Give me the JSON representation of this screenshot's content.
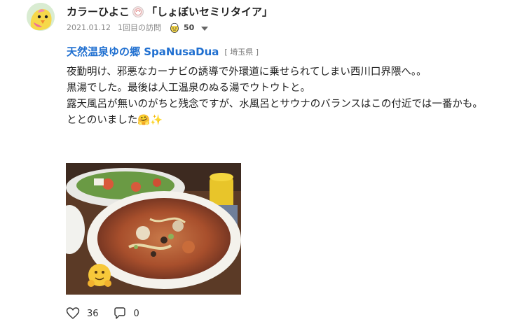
{
  "user": {
    "name": "カラーひよこ",
    "title": "「しょぼいセミリタイア」"
  },
  "meta": {
    "date": "2021.01.12",
    "visit": "1回目の訪問",
    "sauna_count": "50"
  },
  "facility": {
    "name": "天然温泉ゆの郷 SpaNusaDua",
    "prefecture": "[ 埼玉県 ]"
  },
  "post": {
    "lines": [
      "夜勤明け、邪悪なカーナビの誘導で外環道に乗せられてしまい西川口界隈へ。。",
      "黒湯でした。最後は人工温泉のぬる湯でウトウトと。",
      "露天風呂が無いのがちと残念ですが、水風呂とサウナのバランスはこの付近では一番かも。",
      "ととのいました"
    ],
    "emoji": "🤗✨"
  },
  "actions": {
    "likes": "36",
    "comments": "0"
  },
  "icons": [
    "avatar-chick",
    "badge-icon",
    "sauna-man-icon",
    "chevron-down-icon",
    "heart-icon",
    "comment-icon",
    "hug-emoji-icon"
  ]
}
